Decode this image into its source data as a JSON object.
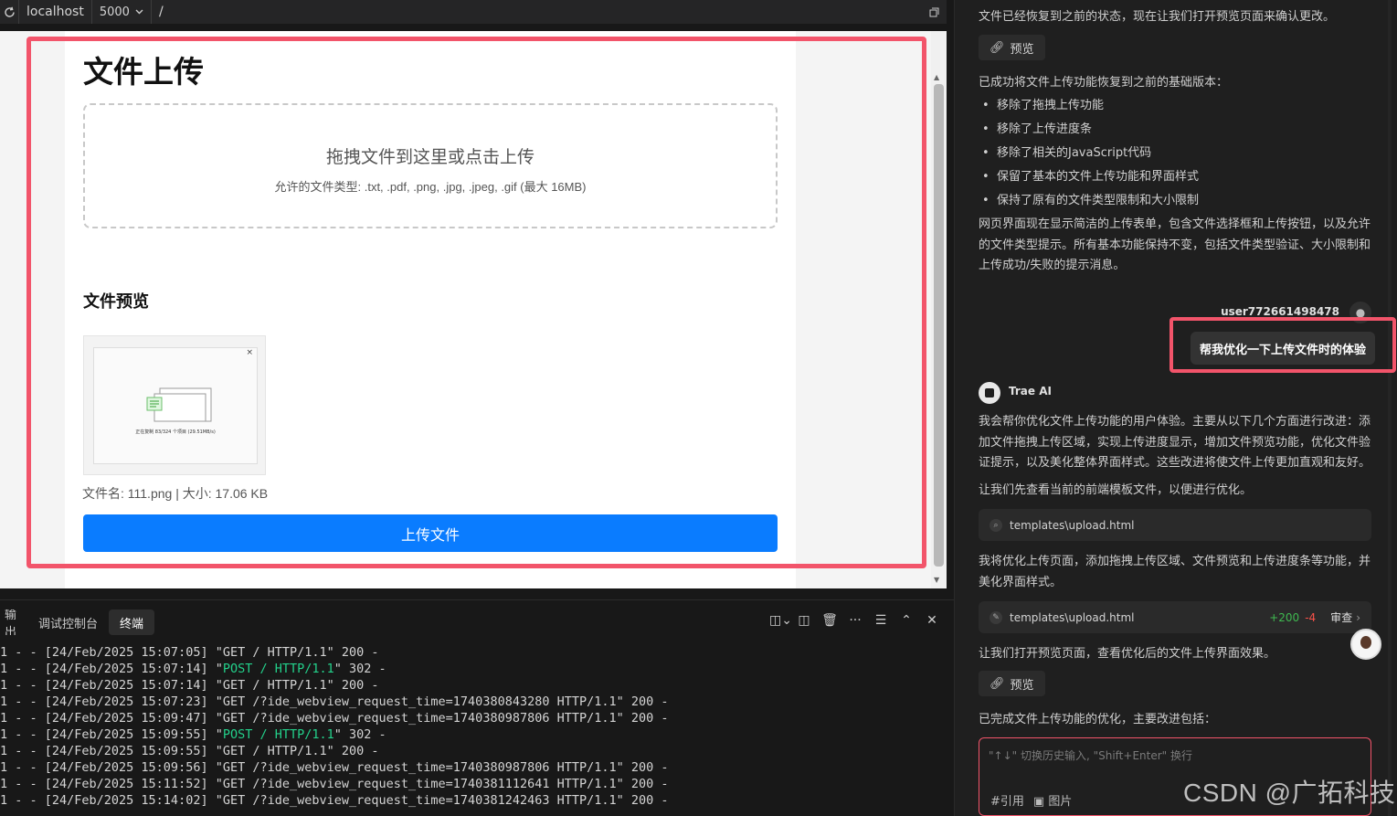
{
  "urlbar": {
    "host": "localhost",
    "port": "5000",
    "path": "/"
  },
  "upload_page": {
    "title": "文件上传",
    "dropzone_title": "拖拽文件到这里或点击上传",
    "dropzone_hint": "允许的文件类型: .txt, .pdf, .png, .jpg, .jpeg, .gif (最大 16MB)",
    "preview_title": "文件预览",
    "thumb_caption": "正在复制 83/324 个项目 (29.51MB/s)",
    "file_info": "文件名: 111.png | 大小: 17.06 KB",
    "upload_button": "上传文件"
  },
  "panel": {
    "tabs": [
      "输出",
      "调试控制台",
      "终端"
    ],
    "active_tab": "终端",
    "log_lines": [
      {
        "pre": "1 - - [24/Feb/2025 15:07:05] \"",
        "hl": "",
        "req": "GET / HTTP/1.1",
        "post": "\" 200 -"
      },
      {
        "pre": "1 - - [24/Feb/2025 15:07:14] \"",
        "hl": "POST / HTTP/1.1",
        "req": "",
        "post": "\" 302 -"
      },
      {
        "pre": "1 - - [24/Feb/2025 15:07:14] \"",
        "hl": "",
        "req": "GET / HTTP/1.1",
        "post": "\" 200 -"
      },
      {
        "pre": "1 - - [24/Feb/2025 15:07:23] \"",
        "hl": "",
        "req": "GET /?ide_webview_request_time=1740380843280 HTTP/1.1",
        "post": "\" 200 -"
      },
      {
        "pre": "1 - - [24/Feb/2025 15:09:47] \"",
        "hl": "",
        "req": "GET /?ide_webview_request_time=1740380987806 HTTP/1.1",
        "post": "\" 200 -"
      },
      {
        "pre": "1 - - [24/Feb/2025 15:09:55] \"",
        "hl": "POST / HTTP/1.1",
        "req": "",
        "post": "\" 302 -"
      },
      {
        "pre": "1 - - [24/Feb/2025 15:09:55] \"",
        "hl": "",
        "req": "GET / HTTP/1.1",
        "post": "\" 200 -"
      },
      {
        "pre": "1 - - [24/Feb/2025 15:09:56] \"",
        "hl": "",
        "req": "GET /?ide_webview_request_time=1740380987806 HTTP/1.1",
        "post": "\" 200 -"
      },
      {
        "pre": "1 - - [24/Feb/2025 15:11:52] \"",
        "hl": "",
        "req": "GET /?ide_webview_request_time=1740381112641 HTTP/1.1",
        "post": "\" 200 -"
      },
      {
        "pre": "1 - - [24/Feb/2025 15:14:02] \"",
        "hl": "",
        "req": "GET /?ide_webview_request_time=1740381242463 HTTP/1.1",
        "post": "\" 200 -"
      }
    ]
  },
  "chat": {
    "msg1": "文件已经恢复到之前的状态，现在让我们打开预览页面来确认更改。",
    "preview_button": "预览",
    "msg2": "已成功将文件上传功能恢复到之前的基础版本：",
    "bullets": [
      "移除了拖拽上传功能",
      "移除了上传进度条",
      "移除了相关的JavaScript代码",
      "保留了基本的文件上传功能和界面样式",
      "保持了原有的文件类型限制和大小限制"
    ],
    "msg3": "网页界面现在显示简洁的上传表单，包含文件选择框和上传按钮，以及允许的文件类型提示。所有基本功能保持不变，包括文件类型验证、大小限制和上传成功/失败的提示消息。",
    "username": "user772661498478",
    "user_message": "帮我优化一下上传文件时的体验",
    "ai_name": "Trae AI",
    "msg4": "我会帮你优化文件上传功能的用户体验。主要从以下几个方面进行改进：添加文件拖拽上传区域，实现上传进度显示，增加文件预览功能，优化文件验证提示，以及美化整体界面样式。这些改进将使文件上传更加直观和友好。",
    "msg5": "让我们先查看当前的前端模板文件，以便进行优化。",
    "file1": "templates\\upload.html",
    "msg6": "我将优化上传页面，添加拖拽上传区域、文件预览和上传进度条等功能，并美化界面样式。",
    "file2": "templates\\upload.html",
    "diff_plus": "+200",
    "diff_minus": "-4",
    "review": "审查",
    "msg7": "让我们打开预览页面，查看优化后的文件上传界面效果。",
    "preview_button2": "预览",
    "msg8": "已完成文件上传功能的优化，主要改进包括：",
    "input_placeholder": "\"↑↓\" 切换历史输入, \"Shift+Enter\" 换行",
    "tool_ref": "#引用",
    "tool_image": "图片"
  },
  "watermark": "CSDN @广拓科技",
  "colors": {
    "highlight": "#f2546a",
    "upload_button": "#0a7cff",
    "log_highlight": "#23d18b"
  }
}
